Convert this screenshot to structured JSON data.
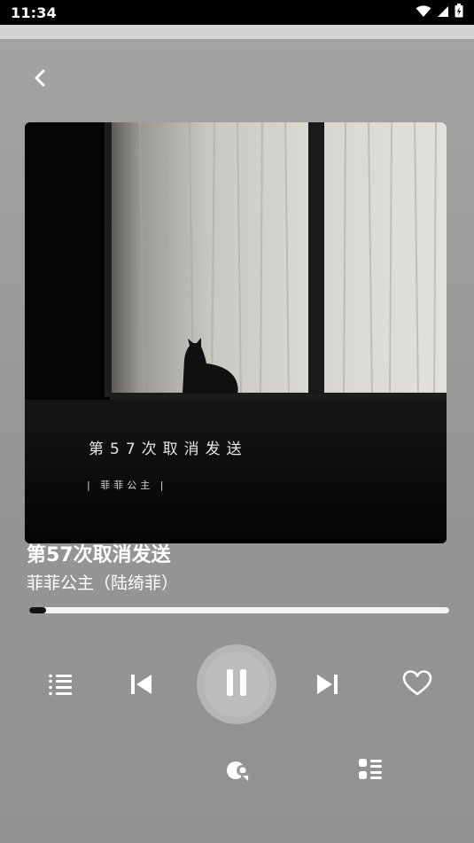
{
  "status_bar": {
    "time": "11:34",
    "icons": [
      "wifi-icon",
      "signal-icon",
      "battery-icon"
    ]
  },
  "navigation": {
    "back_icon": "chevron-left-icon"
  },
  "album_art": {
    "text_title": "第57次取消发送",
    "text_artist": "| 菲菲公主 |"
  },
  "track": {
    "title": "第57次取消发送",
    "artist": "菲菲公主（陆绮菲）",
    "progress": 0.04
  },
  "controls": {
    "playlist_icon": "playlist-icon",
    "previous_icon": "skip-previous-icon",
    "play_pause_icon": "pause-icon",
    "next_icon": "skip-next-icon",
    "favorite_icon": "heart-icon",
    "share_icon": "share-icon",
    "more_icon": "list-icon"
  },
  "colors": {
    "background": "#9a9a9a",
    "status_bar": "#000000",
    "text": "#ffffff",
    "progress_track": "#f3f3f3",
    "progress_fill": "#111111"
  }
}
